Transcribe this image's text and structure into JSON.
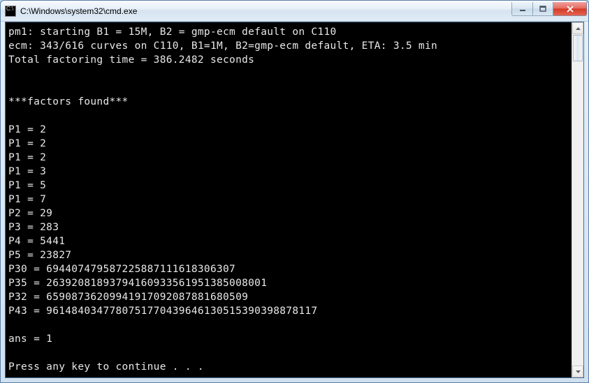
{
  "window": {
    "icon_text": "C:\\",
    "title": "C:\\Windows\\system32\\cmd.exe"
  },
  "console_lines": [
    "pm1: starting B1 = 15M, B2 = gmp-ecm default on C110",
    "ecm: 343/616 curves on C110, B1=1M, B2=gmp-ecm default, ETA: 3.5 min",
    "Total factoring time = 386.2482 seconds",
    "",
    "",
    "***factors found***",
    "",
    "P1 = 2",
    "P1 = 2",
    "P1 = 2",
    "P1 = 3",
    "P1 = 5",
    "P1 = 7",
    "P2 = 29",
    "P3 = 283",
    "P4 = 5441",
    "P5 = 23827",
    "P30 = 694407479587225887111618306307",
    "P35 = 26392081893794160933561951385008001",
    "P32 = 65908736209941917092087881680509",
    "P43 = 9614840347780751770439646130515390398878117",
    "",
    "ans = 1",
    "",
    "Press any key to continue . . ."
  ]
}
